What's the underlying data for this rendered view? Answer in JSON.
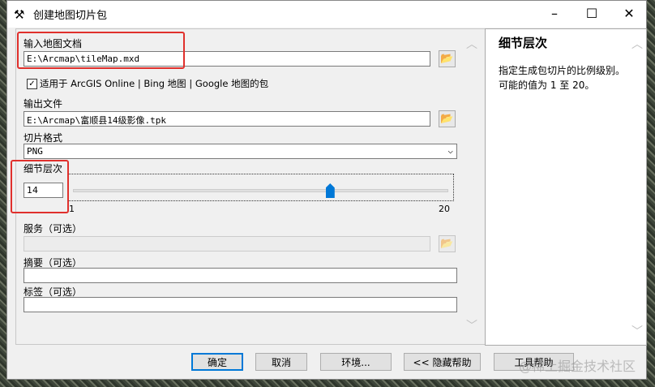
{
  "window": {
    "title": "创建地图切片包",
    "minimize": "–",
    "maximize": "☐",
    "close": "✕"
  },
  "form": {
    "input_map_label": "输入地图文档",
    "input_map_value": "E:\\Arcmap\\tileMap.mxd",
    "checkbox_label": "适用于 ArcGIS Online | Bing 地图 | Google 地图的包",
    "checkbox_checked": true,
    "output_label": "输出文件",
    "output_value": "E:\\Arcmap\\富顺县14级影像.tpk",
    "format_label": "切片格式",
    "format_value": "PNG",
    "lod_label": "细节层次",
    "lod_value": "14",
    "lod_min": "1",
    "lod_max": "20",
    "service_label": "服务（可选）",
    "summary_label": "摘要（可选）",
    "tags_label": "标签（可选）"
  },
  "help": {
    "title": "细节层次",
    "text": "指定生成包切片的比例级别。可能的值为 1 至 20。"
  },
  "buttons": {
    "ok": "确定",
    "cancel": "取消",
    "env": "环境...",
    "hide_help": "<< 隐藏帮助",
    "tool_help": "工具帮助"
  },
  "watermark": "@稀土掘金技术社区"
}
